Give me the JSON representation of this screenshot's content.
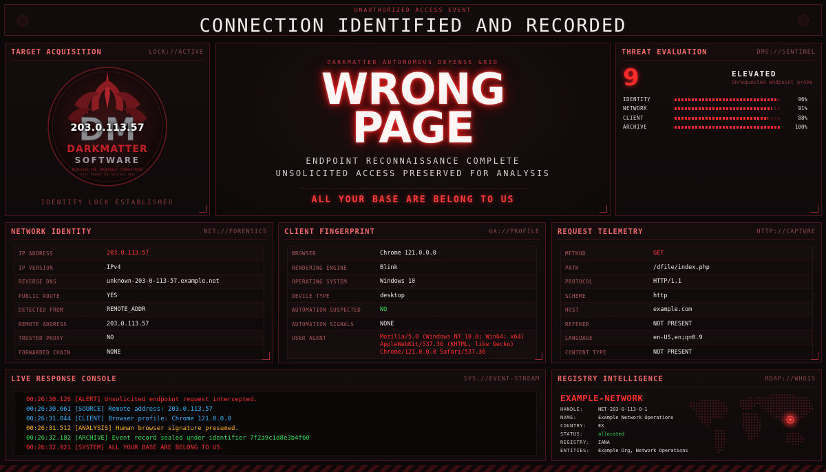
{
  "header": {
    "kicker": "UNAUTHORIZED ACCESS EVENT",
    "title": "CONNECTION IDENTIFIED AND RECORDED"
  },
  "target": {
    "title": "TARGET ACQUISITION",
    "tag": "LOCK://ACTIVE",
    "ip": "203.0.113.57",
    "logo_brand": "DARKMATTER",
    "logo_sub": "SOFTWARE",
    "logo_tagline1": "BUILDING THE INVISIBLE FOUNDATIONS",
    "logo_tagline2": "THAT POWER THE VISIBLE WEB",
    "status": "IDENTITY LOCK ESTABLISHED"
  },
  "main": {
    "kicker": "DARKMATTER AUTONOMOUS DEFENSE GRID",
    "line1": "WRONG",
    "line2": "PAGE",
    "sub1": "ENDPOINT RECONNAISSANCE COMPLETE",
    "sub2": "UNSOLICITED ACCESS PRESERVED FOR ANALYSIS",
    "cta": "ALL YOUR BASE ARE BELONG TO US"
  },
  "threat": {
    "title": "THREAT EVALUATION",
    "tag": "DMS://SENTINEL",
    "score": "9",
    "level": "ELEVATED",
    "level_sub": "Unrequested endpoint probe",
    "meters": [
      {
        "label": "IDENTITY",
        "value": 96,
        "display": "96%"
      },
      {
        "label": "NETWORK",
        "value": 91,
        "display": "91%"
      },
      {
        "label": "CLIENT",
        "value": 88,
        "display": "88%"
      },
      {
        "label": "ARCHIVE",
        "value": 100,
        "display": "100%"
      }
    ]
  },
  "network": {
    "title": "NETWORK IDENTITY",
    "tag": "NET://FORENSICS",
    "rows": [
      {
        "k": "IP ADDRESS",
        "v": "203.0.113.57"
      },
      {
        "k": "IP VERSION",
        "v": "IPv4"
      },
      {
        "k": "REVERSE DNS",
        "v": "unknown-203-0-113-57.example.net"
      },
      {
        "k": "PUBLIC ROUTE",
        "v": "YES"
      },
      {
        "k": "DETECTED FROM",
        "v": "REMOTE_ADDR"
      },
      {
        "k": "REMOTE ADDRESS",
        "v": "203.0.113.57"
      },
      {
        "k": "TRUSTED PROXY",
        "v": "NO"
      },
      {
        "k": "FORWARDED CHAIN",
        "v": "NONE"
      }
    ]
  },
  "client": {
    "title": "CLIENT FINGERPRINT",
    "tag": "UA://PROFILE",
    "rows": [
      {
        "k": "BROWSER",
        "v": "Chrome 121.0.0.0"
      },
      {
        "k": "RENDERING ENGINE",
        "v": "Blink"
      },
      {
        "k": "OPERATING SYSTEM",
        "v": "Windows 10"
      },
      {
        "k": "DEVICE TYPE",
        "v": "desktop"
      },
      {
        "k": "AUTOMATION SUSPECTED",
        "v": "NO"
      },
      {
        "k": "AUTOMATION SIGNALS",
        "v": "NONE"
      },
      {
        "k": "USER AGENT",
        "v": "Mozilla/5.0 (Windows NT 10.0; Win64; x64) AppleWebKit/537.36 (KHTML, like Gecko) Chrome/121.0.0.0 Safari/537.36"
      }
    ]
  },
  "request": {
    "title": "REQUEST TELEMETRY",
    "tag": "HTTP://CAPTURE",
    "rows": [
      {
        "k": "METHOD",
        "v": "GET"
      },
      {
        "k": "PATH",
        "v": "/dfile/index.php"
      },
      {
        "k": "PROTOCOL",
        "v": "HTTP/1.1"
      },
      {
        "k": "SCHEME",
        "v": "http"
      },
      {
        "k": "HOST",
        "v": "example.com"
      },
      {
        "k": "REFERER",
        "v": "NOT PRESENT"
      },
      {
        "k": "LANGUAGE",
        "v": "en-US,en;q=0.9"
      },
      {
        "k": "CONTENT TYPE",
        "v": "NOT PRESENT"
      }
    ]
  },
  "console": {
    "title": "LIVE RESPONSE CONSOLE",
    "tag": "SYS://EVENT-STREAM",
    "lines": [
      {
        "text": "00:26:30.126  [ALERT] Unsolicited endpoint request intercepted.",
        "color": "#ff3030"
      },
      {
        "text": "00:26:30.661  [SOURCE] Remote address: 203.0.113.57",
        "color": "#3ab4ff"
      },
      {
        "text": "00:26:31.044  [CLIENT] Browser profile: Chrome 121.0.0.0",
        "color": "#3ab4ff"
      },
      {
        "text": "00:26:31.512  [ANALYSIS] Human browser signature presumed.",
        "color": "#ffb020"
      },
      {
        "text": "00:26:32.182  [ARCHIVE] Event record sealed under identifier 7f2a9c1d8e3b4f60",
        "color": "#3adc5a"
      },
      {
        "text": "00:26:32.921  [SYSTEM] ALL YOUR BASE ARE BELONG TO US.",
        "color": "#ff3030"
      }
    ]
  },
  "registry": {
    "title": "REGISTRY INTELLIGENCE",
    "tag": "RDAP://WHOIS",
    "network_name": "EXAMPLE-NETWORK",
    "rows": [
      {
        "k": "HANDLE:",
        "v": "NET-203-0-113-0-1"
      },
      {
        "k": "NAME:",
        "v": "Example Network Operations"
      },
      {
        "k": "COUNTRY:",
        "v": "EX"
      },
      {
        "k": "STATUS:",
        "v": "allocated"
      },
      {
        "k": "REGISTRY:",
        "v": "IANA"
      },
      {
        "k": "ENTITIES:",
        "v": "Example Org, Network Operations"
      }
    ]
  },
  "colors": {
    "accent": "#ff2b2b",
    "panel_border": "#4a1518",
    "background": "#0c0809",
    "ok": "#3adc5a",
    "info": "#3ab4ff",
    "warn": "#ffb020"
  }
}
